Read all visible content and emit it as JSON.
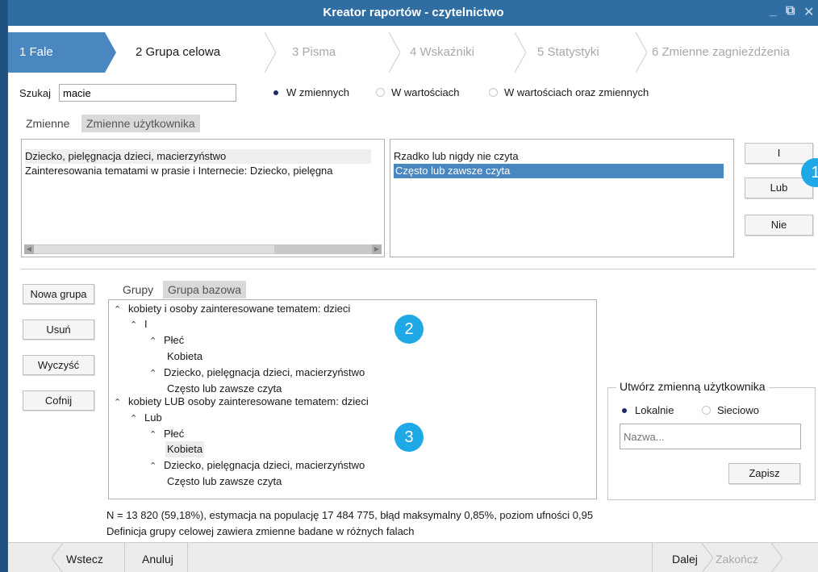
{
  "window": {
    "title": "Kreator raportów - czytelnictwo"
  },
  "steps": [
    {
      "label": "1  Fale"
    },
    {
      "label": "2  Grupa celowa"
    },
    {
      "label": "3  Pisma"
    },
    {
      "label": "4  Wskaźniki"
    },
    {
      "label": "5  Statystyki"
    },
    {
      "label": "6  Zmienne zagnieżdżenia"
    }
  ],
  "search": {
    "label": "Szukaj",
    "value": "macie",
    "options": [
      {
        "label": "W zmiennych",
        "selected": true
      },
      {
        "label": "W wartościach",
        "selected": false
      },
      {
        "label": "W wartościach oraz zmiennych",
        "selected": false
      }
    ]
  },
  "variable_tabs": [
    "Zmienne",
    "Zmienne użytkownika"
  ],
  "variables": [
    "Dziecko, pielęgnacja dzieci, macierzyństwo",
    "Zainteresowania tematami w prasie i Internecie: Dziecko, pielęgna"
  ],
  "values": [
    {
      "label": "Rzadko lub nigdy nie czyta",
      "selected": false
    },
    {
      "label": "Często lub zawsze czyta",
      "selected": true
    }
  ],
  "logic_buttons": {
    "and": "I",
    "or": "Lub",
    "not": "Nie"
  },
  "badges": [
    "1",
    "2",
    "3"
  ],
  "group_actions": {
    "new": "Nowa grupa",
    "delete": "Usuń",
    "clear": "Wyczyść",
    "undo": "Cofnij"
  },
  "group_tabs": [
    "Grupy",
    "Grupa bazowa"
  ],
  "groups_tree": [
    {
      "level": 0,
      "caret": true,
      "text": "kobiety i osoby zainteresowane tematem: dzieci"
    },
    {
      "level": 1,
      "caret": true,
      "text": "I"
    },
    {
      "level": 2,
      "caret": true,
      "text": "Płeć"
    },
    {
      "level": 3,
      "caret": false,
      "text": "Kobieta"
    },
    {
      "level": 2,
      "caret": true,
      "text": "Dziecko, pielęgnacja dzieci, macierzyństwo"
    },
    {
      "level": 3,
      "caret": false,
      "text": "Często lub zawsze czyta"
    },
    {
      "level": 0,
      "caret": true,
      "text": "kobiety LUB osoby zainteresowane tematem: dzieci"
    },
    {
      "level": 1,
      "caret": true,
      "text": "Lub"
    },
    {
      "level": 2,
      "caret": true,
      "text": "Płeć"
    },
    {
      "level": 3,
      "caret": false,
      "text": "Kobieta",
      "highlight": true
    },
    {
      "level": 2,
      "caret": true,
      "text": "Dziecko, pielęgnacja dzieci, macierzyństwo"
    },
    {
      "level": 3,
      "caret": false,
      "text": "Często lub zawsze czyta"
    }
  ],
  "user_variable": {
    "legend": "Utwórz zmienną użytkownika",
    "options": [
      {
        "label": "Lokalnie",
        "selected": true
      },
      {
        "label": "Sieciowo",
        "selected": false
      }
    ],
    "name_placeholder": "Nazwa...",
    "save_label": "Zapisz"
  },
  "status": {
    "line1": "N = 13 820 (59,18%), estymacja na populację 17 484 775, błąd maksymalny 0,85%, poziom ufności 0,95",
    "line2": "Definicja grupy celowej zawiera zmienne badane w różnych falach"
  },
  "footer": {
    "back": "Wstecz",
    "cancel": "Anuluj",
    "next": "Dalej",
    "finish": "Zakończ"
  },
  "colors": {
    "titlebar": "#2f6da3",
    "active_step": "#4a86c0",
    "selection": "#4a86c0",
    "badge": "#1fa8e6"
  }
}
